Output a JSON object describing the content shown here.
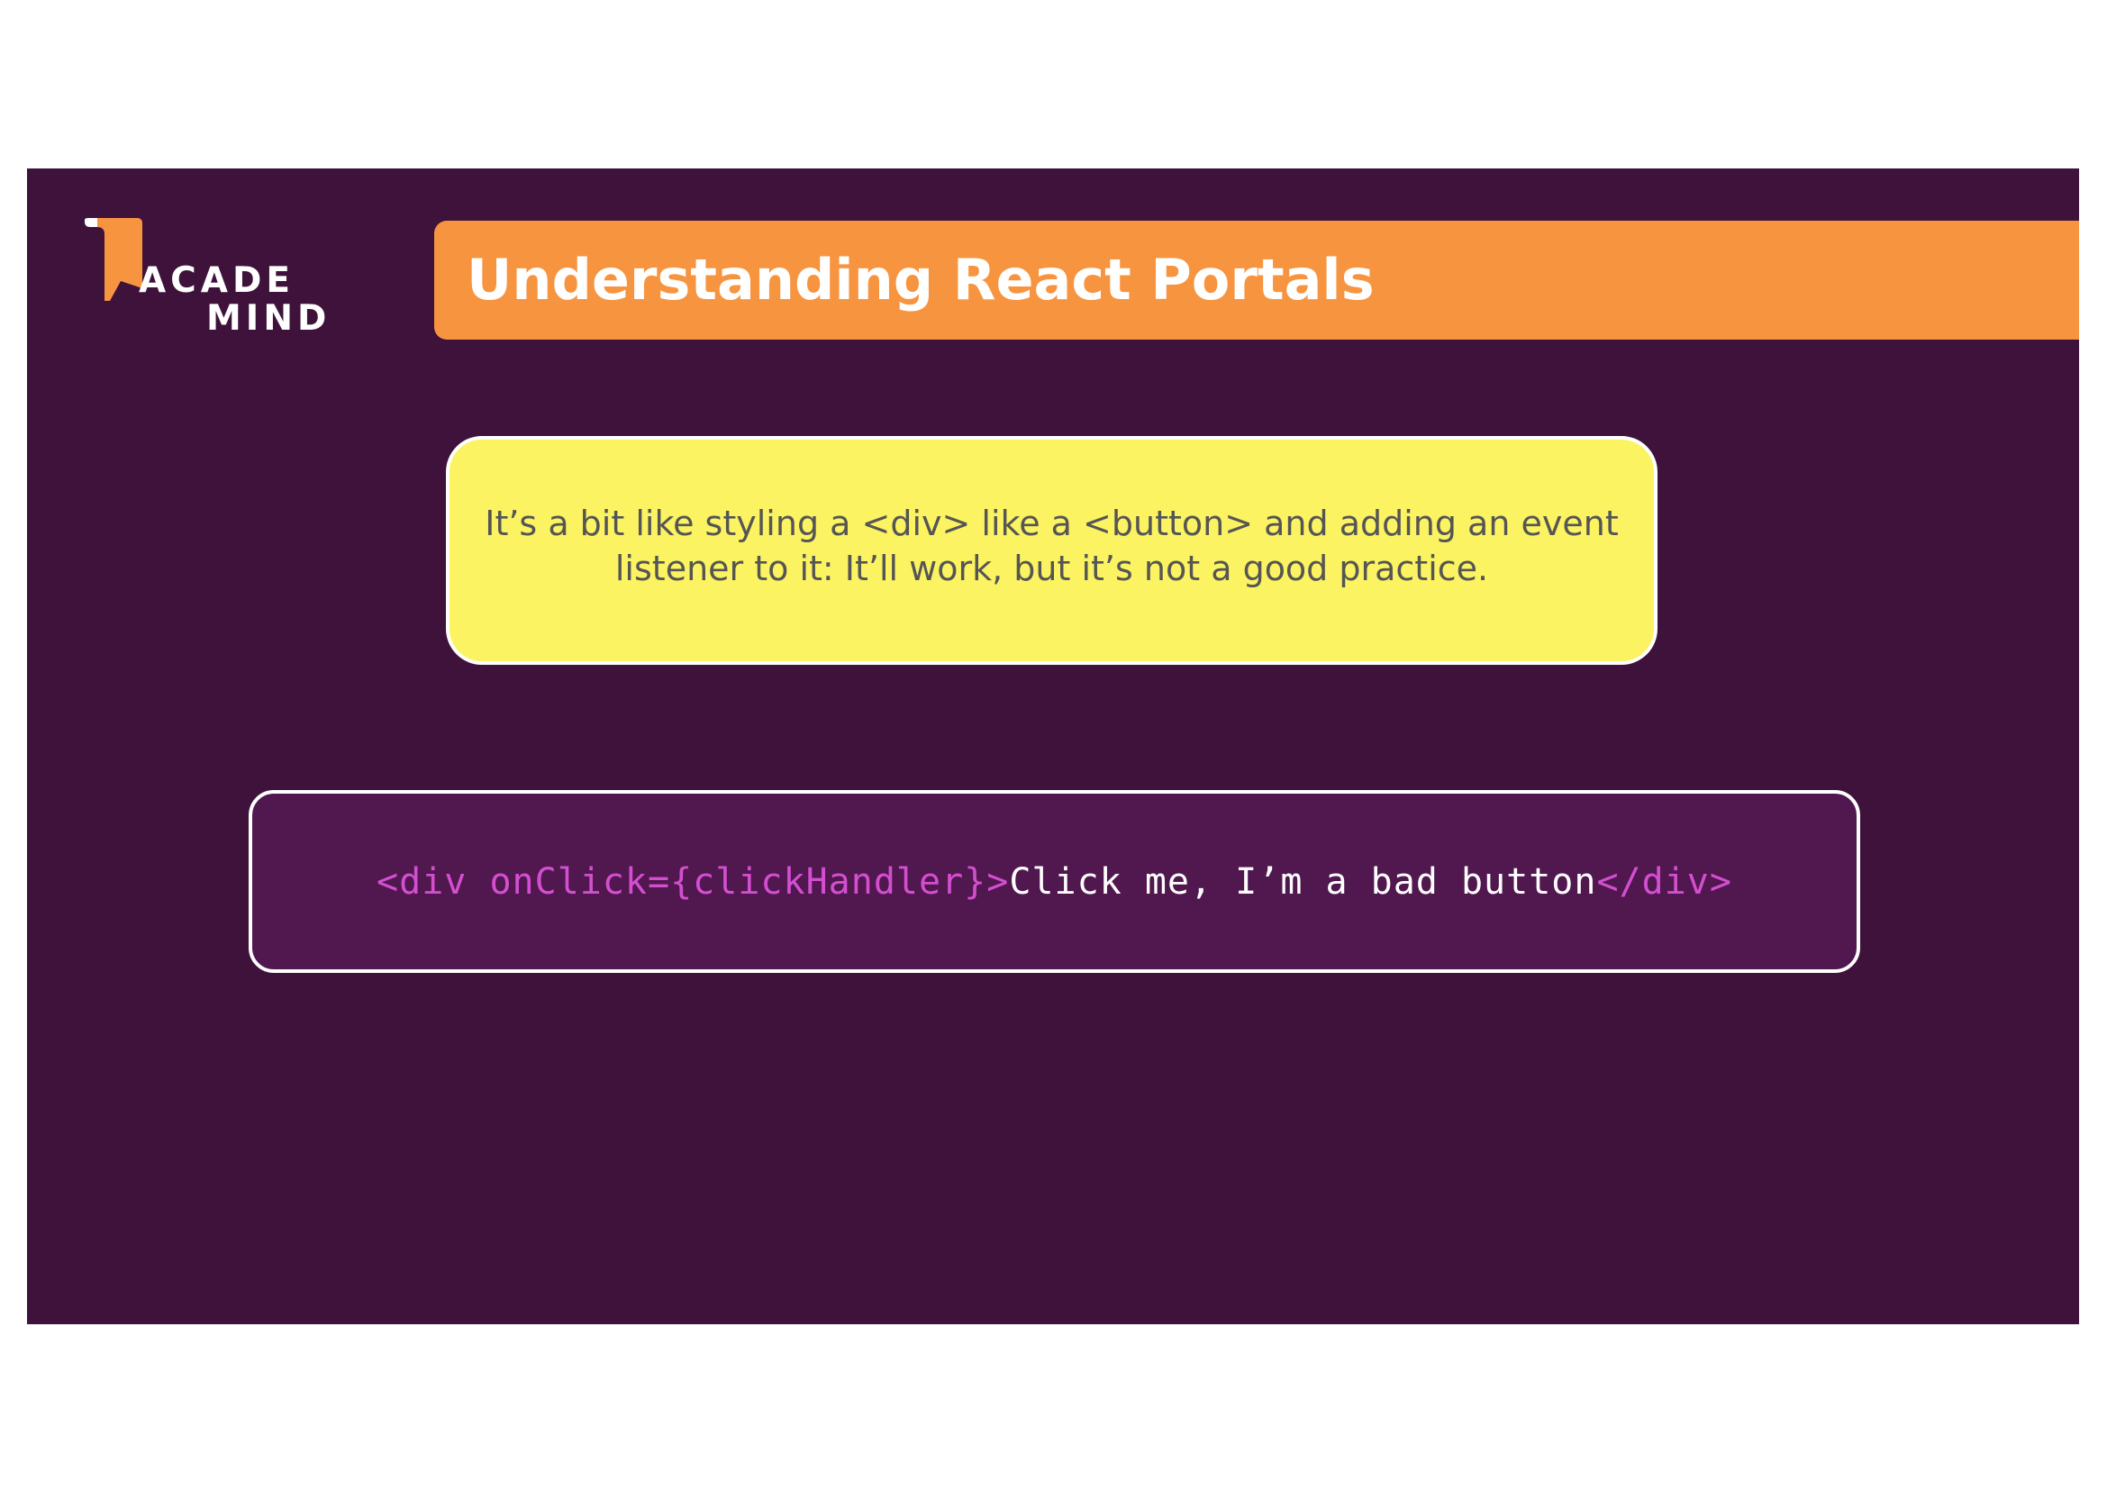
{
  "logo": {
    "line1": "ACADE",
    "line2": "MIND",
    "colors": {
      "accent": "#f79440",
      "text": "#ffffff"
    }
  },
  "title": "Understanding React Portals",
  "note": {
    "text": "It’s a bit like styling a <div> like a <button> and adding an event listener to it: It’ll work, but it’s not a good practice."
  },
  "code": {
    "open_tag": "<div onClick={clickHandler}>",
    "content": "Click me, I’m a bad button",
    "close_tag": "</div>"
  },
  "colors": {
    "slide_background": "#3e123a",
    "title_banner": "#f79440",
    "note_background": "#fbf361",
    "code_background": "#51174f",
    "code_tag": "#d34fd0"
  }
}
